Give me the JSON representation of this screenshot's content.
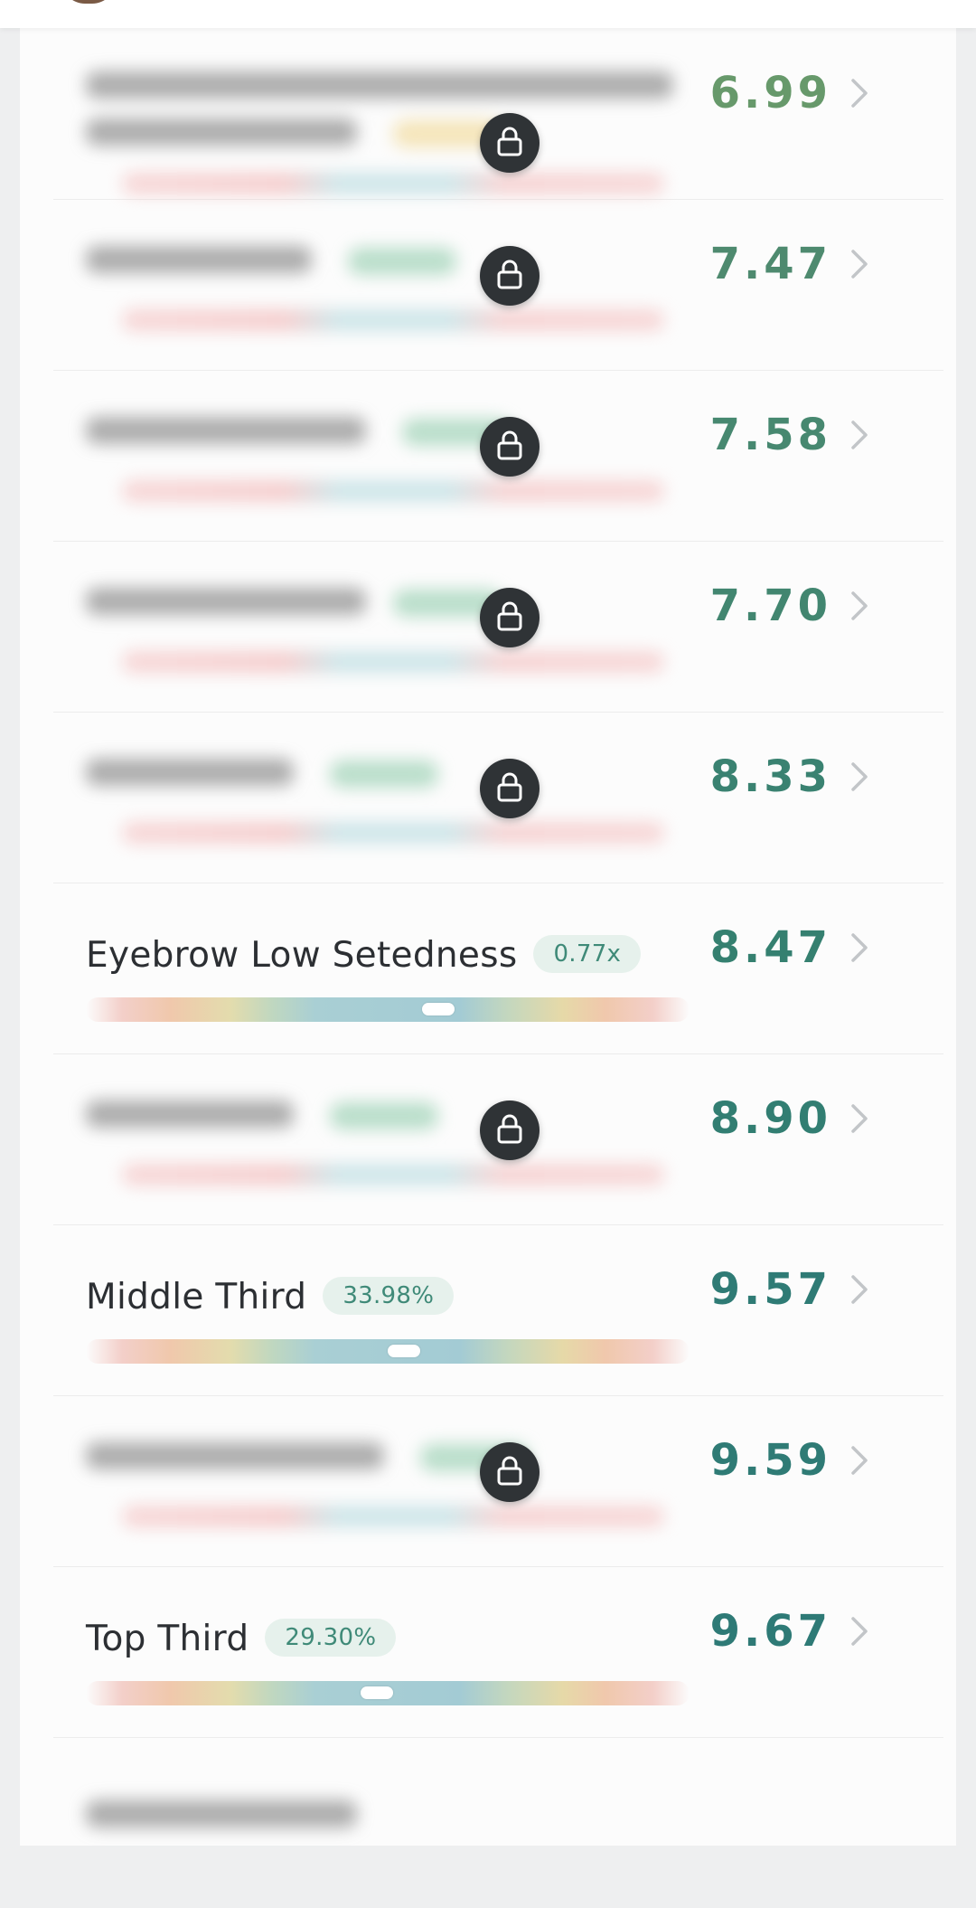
{
  "colors": {
    "score_green": "#67996b",
    "score_teal": "#2f7b75",
    "badge_bg": "#e6f1ec",
    "badge_text": "#3f8a78",
    "lock_bg": "#2f3336"
  },
  "rows": [
    {
      "score": "6.99",
      "locked": true
    },
    {
      "score": "7.47",
      "locked": true
    },
    {
      "score": "7.58",
      "locked": true
    },
    {
      "score": "7.70",
      "locked": true
    },
    {
      "score": "8.33",
      "locked": true
    },
    {
      "score": "8.47",
      "locked": false,
      "label": "Eyebrow Low Setedness",
      "badge": "0.77x",
      "position": 0.585
    },
    {
      "score": "8.90",
      "locked": true
    },
    {
      "score": "9.57",
      "locked": false,
      "label": "Middle Third",
      "badge": "33.98%",
      "position": 0.53
    },
    {
      "score": "9.59",
      "locked": true
    },
    {
      "score": "9.67",
      "locked": false,
      "label": "Top Third",
      "badge": "29.30%",
      "position": 0.485
    }
  ]
}
